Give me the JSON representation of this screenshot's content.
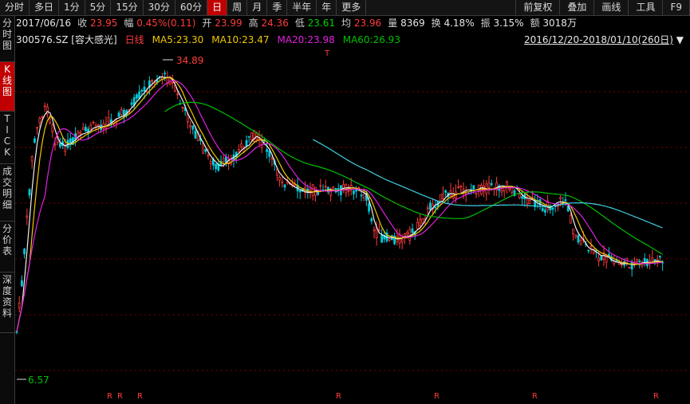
{
  "tabs": [
    "分时",
    "多日",
    "1分",
    "5分",
    "15分",
    "30分",
    "60分",
    "日",
    "周",
    "月",
    "季",
    "半年",
    "年",
    "更多"
  ],
  "active_tab": "日",
  "right_tabs": [
    "前复权",
    "叠加",
    "画线",
    "工具",
    "F9"
  ],
  "sidebar": [
    "分时图",
    "K线图",
    "TICK",
    "成交明细",
    "分价表",
    "深度资料"
  ],
  "sidebar_active": "K线图",
  "info": {
    "date": "2017/06/16",
    "close_label": "收",
    "close": "23.95",
    "change_label": "幅",
    "change": "0.45%(0.11)",
    "open_label": "开",
    "open": "23.99",
    "high_label": "高",
    "high": "24.36",
    "low_label": "低",
    "low": "23.61",
    "avg_label": "均",
    "avg": "23.96",
    "volume_label": "量",
    "volume": "8369",
    "turnover_label": "换",
    "turnover": "4.18%",
    "amplitude_label": "振",
    "amplitude": "3.15%",
    "amount_label": "额",
    "amount": "3018万"
  },
  "ma": {
    "code": "300576.SZ [容大感光]",
    "period": "日线",
    "ma5": "MA5:23.30",
    "ma10": "MA10:23.47",
    "ma20": "MA20:23.98",
    "ma60": "MA60:26.93"
  },
  "range": {
    "text": "2016/12/20-2018/01/10(260日)"
  },
  "colors": {
    "up": "#ff3b3b",
    "down": "#00c8d8",
    "ma5": "#f0f0f0",
    "ma10": "#f0c800",
    "ma20": "#e020e0",
    "ma60": "#00c000",
    "ma120": "#40d0e0"
  },
  "chart_data": {
    "type": "candlestick",
    "annotations": {
      "high": "34.89",
      "low": "6.57"
    },
    "markers": {
      "R": "R",
      "T": "T"
    }
  }
}
